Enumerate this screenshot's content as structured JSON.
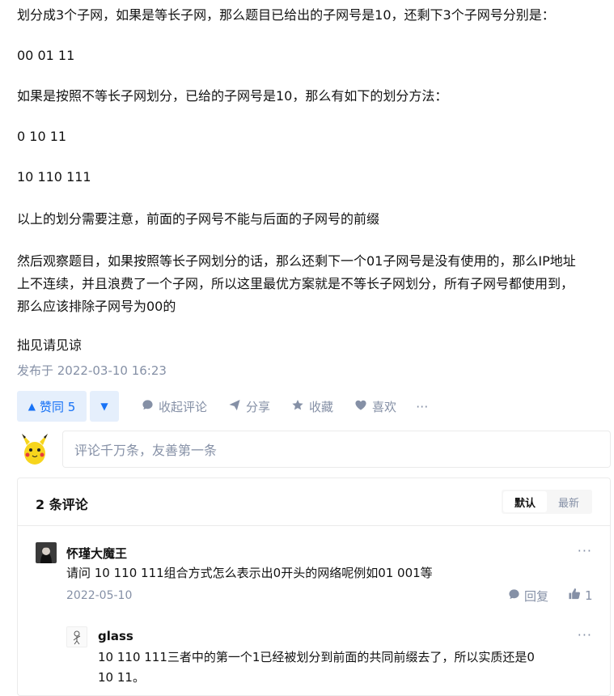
{
  "article": {
    "paragraphs": [
      "划分成3个子网，如果是等长子网，那么题目已给出的子网号是10，还剩下3个子网号分别是：",
      "00 01 11",
      "如果是按照不等长子网划分，已给的子网号是10，那么有如下的划分方法：",
      "0 10 11",
      "10 110 111",
      "以上的划分需要注意，前面的子网号不能与后面的子网号的前缀",
      "然后观察题目，如果按照等长子网划分的话，那么还剩下一个01子网号是没有使用的，那么IP地址",
      "上不连续，并且浪费了一个子网，所以这里最优方案就是不等长子网划分，所有子网号都使用到，",
      "那么应该排除子网号为00的",
      "拙见请见谅"
    ],
    "published": "发布于 2022-03-10 16:23"
  },
  "actions": {
    "upvote": "赞同 5",
    "collapse_comments": "收起评论",
    "share": "分享",
    "favorite": "收藏",
    "like": "喜欢",
    "more": "···"
  },
  "comment_box": {
    "placeholder": "评论千万条，友善第一条"
  },
  "comments_panel": {
    "title": "2 条评论",
    "sort_default": "默认",
    "sort_latest": "最新",
    "comments": [
      {
        "author": "怀瑾大魔王",
        "text": "请问 10 110 111组合方式怎么表示出0开头的网络呢例如01 001等",
        "date": "2022-05-10",
        "reply_label": "回复",
        "likes": "1",
        "more": "···"
      },
      {
        "author": "glass",
        "text_line1": "10 110 111三者中的第一个1已经被划分到前面的共同前缀去了，所以实质还是0",
        "text_line2": "10 11。",
        "more": "···"
      }
    ]
  },
  "colors": {
    "accent": "#1772f6",
    "accent_bg": "#e5effc",
    "muted": "#8590a6"
  }
}
